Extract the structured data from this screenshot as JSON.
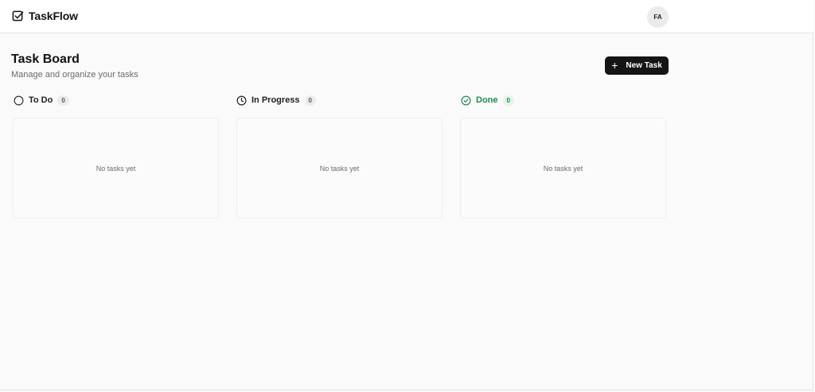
{
  "app": {
    "name": "TaskFlow",
    "brand_icon": "checkbox-icon"
  },
  "user": {
    "initials": "FA"
  },
  "page": {
    "title": "Task Board",
    "subtitle": "Manage and organize your tasks"
  },
  "actions": {
    "new_task_label": "New Task",
    "new_task_icon": "plus-icon"
  },
  "columns": [
    {
      "id": "todo",
      "title": "To Do",
      "count": "0",
      "icon": "circle-icon",
      "empty_text": "No tasks yet"
    },
    {
      "id": "in_progress",
      "title": "In Progress",
      "count": "0",
      "icon": "clock-icon",
      "empty_text": "No tasks yet"
    },
    {
      "id": "done",
      "title": "Done",
      "count": "0",
      "icon": "check-circle-icon",
      "empty_text": "No tasks yet",
      "accent": "#1f8a4c"
    }
  ]
}
